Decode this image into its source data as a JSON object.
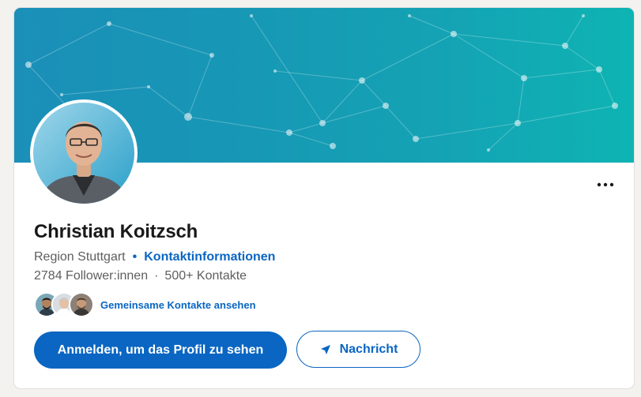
{
  "profile": {
    "name": "Christian Koitzsch",
    "location": "Region Stuttgart",
    "contact_info_label": "Kontaktinformationen",
    "followers": "2784 Follower:innen",
    "separator": "·",
    "connections": "500+ Kontakte",
    "bullet": "•"
  },
  "mutual": {
    "label": "Gemeinsame Kontakte ansehen",
    "avatar_count": 3
  },
  "actions": {
    "primary_label": "Anmelden, um das Profil zu sehen",
    "message_label": "Nachricht",
    "more_label": "···"
  },
  "icons": {
    "more": "more-horizontal-icon",
    "message": "send-icon"
  },
  "colors": {
    "accent": "#0a66c2",
    "banner_start": "#1b8fb8",
    "banner_end": "#0eb4b3"
  }
}
